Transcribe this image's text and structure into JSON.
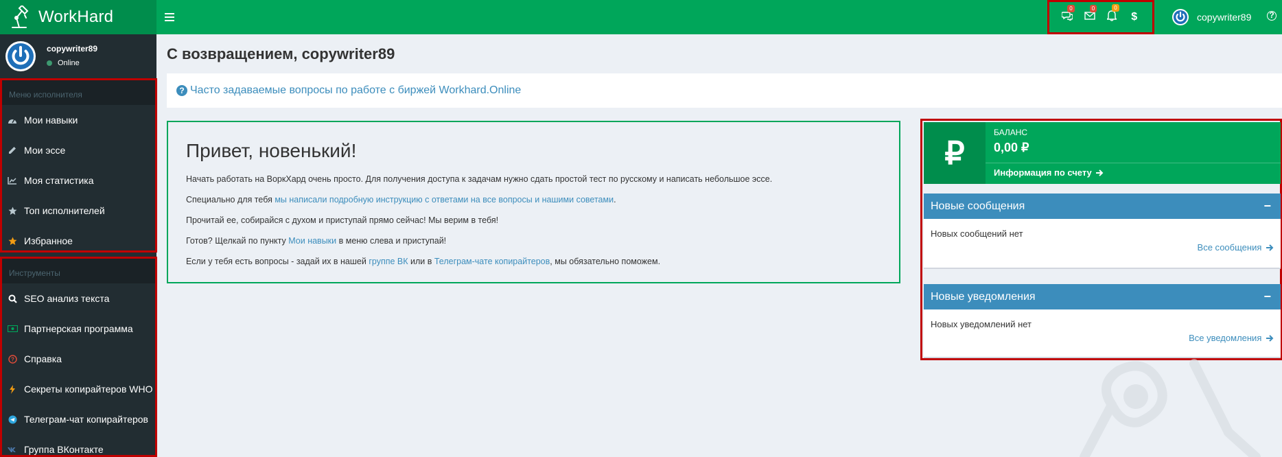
{
  "app": {
    "name": "WorkHard"
  },
  "topbar": {
    "messages_count": "0",
    "mail_count": "0",
    "notifications_count": "0",
    "balance_symbol": "$",
    "username": "copywriter89",
    "help_glyph": "?"
  },
  "sidebar": {
    "user": {
      "name": "copywriter89",
      "status": "Online"
    },
    "section1": {
      "header": "Меню исполнителя",
      "items": [
        {
          "label": "Мои навыки",
          "icon": "dashboard-icon"
        },
        {
          "label": "Мои эссе",
          "icon": "pencil-icon"
        },
        {
          "label": "Моя статистика",
          "icon": "line-chart-icon"
        },
        {
          "label": "Топ исполнителей",
          "icon": "star-icon"
        },
        {
          "label": "Избранное",
          "icon": "star-orange-icon"
        }
      ]
    },
    "section2": {
      "header": "Инструменты",
      "items": [
        {
          "label": "SEO анализ текста",
          "icon": "search-icon"
        },
        {
          "label": "Партнерская программа",
          "icon": "money-icon"
        },
        {
          "label": "Справка",
          "icon": "help-icon"
        },
        {
          "label": "Секреты копирайтеров WHO",
          "icon": "bolt-icon"
        },
        {
          "label": "Телеграм-чат копирайтеров",
          "icon": "telegram-icon"
        },
        {
          "label": "Группа ВКонтакте",
          "icon": "vk-icon"
        }
      ]
    }
  },
  "main": {
    "page_title": "С возвращением, copywriter89",
    "faq_link": "Часто задаваемые вопросы по работе с биржей Workhard.Online",
    "welcome": {
      "title": "Привет, новенький!",
      "p1": "Начать работать на ВоркХард очень просто. Для получения доступа к задачам нужно сдать простой тест по русскому и написать небольшое эссе.",
      "p2_before": "Специально для тебя ",
      "p2_link": "мы написали подробную инструкцию с ответами на все вопросы и нашими советами",
      "p2_after": ".",
      "p3": "Прочитай ее, собирайся с духом и приступай прямо сейчас! Мы верим в тебя!",
      "p4_before": "Готов? Щелкай по пункту ",
      "p4_link": "Мои навыки",
      "p4_after": " в меню слева и приступай!",
      "p5_before": "Если у тебя есть вопросы - задай их в нашей ",
      "p5_link1": "группе ВК",
      "p5_mid": " или в ",
      "p5_link2": "Телеграм-чате копирайтеров",
      "p5_after": ", мы обязательно поможем."
    }
  },
  "right": {
    "balance": {
      "symbol": "₽",
      "label": "БАЛАНС",
      "value": "0,00 ₽",
      "info_link": "Информация по счету"
    },
    "messages": {
      "title": "Новые сообщения",
      "collapse": "−",
      "empty": "Новых сообщений нет",
      "link": "Все сообщения"
    },
    "notifications": {
      "title": "Новые уведомления",
      "collapse": "−",
      "empty": "Новых уведомлений нет",
      "link": "Все уведомления"
    }
  },
  "colors": {
    "brand_green": "#00a65a",
    "brand_green_dark": "#008d4c",
    "sidebar_bg": "#222d32",
    "panel_blue": "#3c8dbc",
    "highlight_red": "#c00000"
  }
}
